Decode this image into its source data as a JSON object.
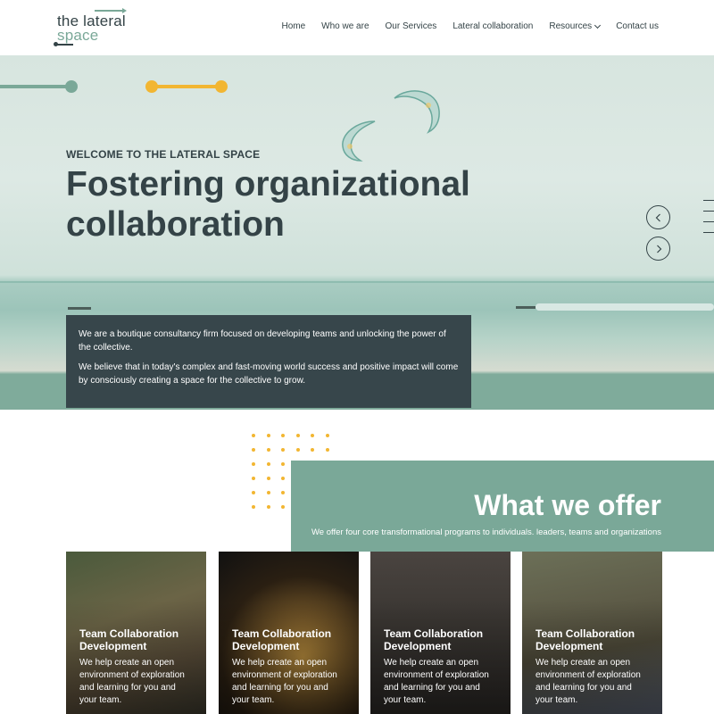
{
  "logo": {
    "line1": "the lateral",
    "line2": "space"
  },
  "nav": {
    "home": "Home",
    "who": "Who we are",
    "services": "Our Services",
    "lateral": "Lateral collaboration",
    "resources": "Resources",
    "contact": "Contact us"
  },
  "hero": {
    "eyebrow": "WELCOME TO THE LATERAL SPACE",
    "headline": "Fostering organizational collaboration",
    "intro_p1": "We are a boutique consultancy firm focused on developing teams and unlocking the power of the collective.",
    "intro_p2": "We believe that in today's complex and fast-moving world success and positive impact will come by consciously creating a space for the collective to grow."
  },
  "offer": {
    "title": "What we offer",
    "subtitle": "We offer four core transformational programs to individuals. leaders, teams and organizations"
  },
  "cards": [
    {
      "title": "Team Collaboration Development",
      "text": "We help create an open environment of exploration and learning for you and your team."
    },
    {
      "title": "Team Collaboration Development",
      "text": "We help create an open environment of exploration and learning for you and your team."
    },
    {
      "title": "Team Collaboration Development",
      "text": "We help create an open environment of exploration and learning for you and your team."
    },
    {
      "title": "Team Collaboration Development",
      "text": "We help create an open environment of exploration and learning for you and your team."
    }
  ],
  "colors": {
    "accent_green": "#7aa898",
    "accent_yellow": "#f2b632",
    "dark": "#344347",
    "intro_box": "#37464b"
  }
}
